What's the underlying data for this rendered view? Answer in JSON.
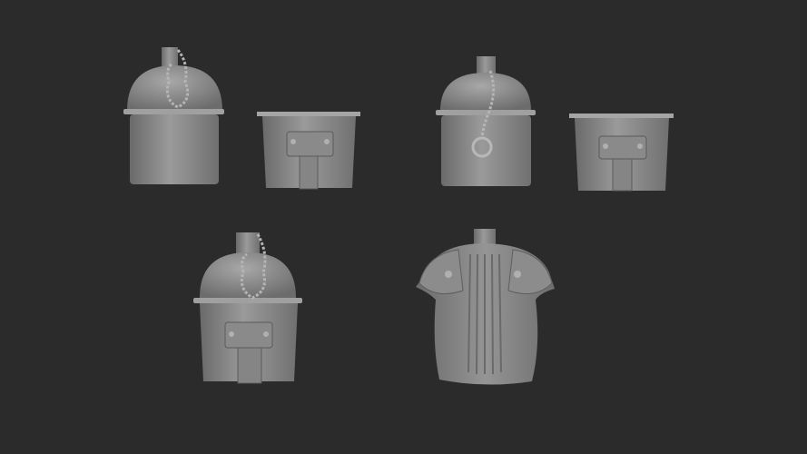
{
  "scene": {
    "background_color": "#2b2b2b",
    "model_color": "#8e8e8e",
    "objects": [
      "canteen-with-chain",
      "canteen-cup",
      "canteen-with-ring",
      "canteen-cup-side",
      "canteen-assembled",
      "canteen-with-cover"
    ]
  }
}
